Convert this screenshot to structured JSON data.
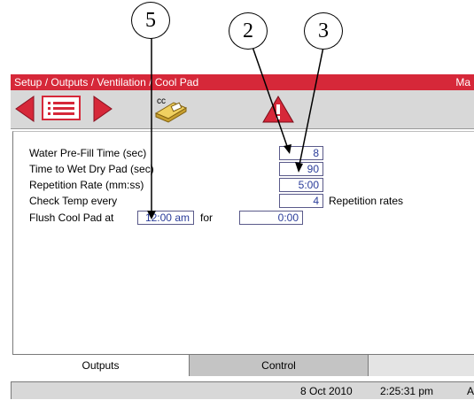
{
  "callouts": [
    "5",
    "2",
    "3"
  ],
  "window": {
    "title": "Setup / Outputs / Ventilation / Cool Pad",
    "title_right": "Ma"
  },
  "toolbar": {
    "back_icon": "left-arrow-icon",
    "list_icon": "list-icon",
    "forward_icon": "right-arrow-icon",
    "copy_icon": "copy-cc-icon",
    "copy_label": "cc",
    "alarm_icon": "alarm-icon",
    "colors": {
      "accent": "#d62839",
      "arrow": "#d62839"
    }
  },
  "settings": {
    "water_prefill": {
      "label": "Water Pre-Fill Time (sec)",
      "value": "8"
    },
    "time_to_wet": {
      "label": "Time to Wet Dry Pad (sec)",
      "value": "90"
    },
    "repetition_rate": {
      "label": "Repetition Rate (mm:ss)",
      "value": "5:00"
    },
    "check_temp": {
      "label": "Check Temp every",
      "value": "4",
      "suffix": "Repetition rates"
    },
    "flush": {
      "label": "Flush Cool Pad at",
      "time": "12:00 am",
      "for_label": "for",
      "duration": "0:00"
    }
  },
  "tabs": [
    {
      "label": "Outputs",
      "active": true
    },
    {
      "label": "Control",
      "active": false
    }
  ],
  "status": {
    "date": "8 Oct 2010",
    "time": "2:25:31 pm",
    "trailing": "A"
  }
}
